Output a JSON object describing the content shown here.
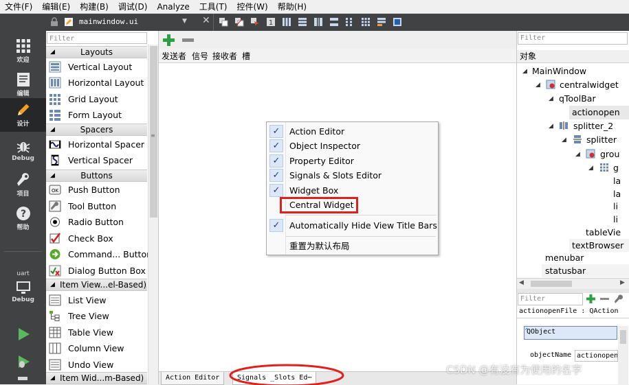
{
  "menubar": {
    "items": [
      "文件(F)",
      "编辑(E)",
      "构建(B)",
      "调试(D)",
      "Analyze",
      "工具(T)",
      "控件(W)",
      "帮助(H)"
    ]
  },
  "modes": [
    {
      "label": "欢迎",
      "icon": "grid-icon"
    },
    {
      "label": "编辑",
      "icon": "document-icon"
    },
    {
      "label": "设计",
      "icon": "pencil-icon",
      "active": true
    },
    {
      "label": "Debug",
      "icon": "bug-icon"
    },
    {
      "label": "项目",
      "icon": "wrench-icon"
    },
    {
      "label": "帮助",
      "icon": "help-icon"
    }
  ],
  "kit": {
    "name": "uart",
    "mode": "Debug"
  },
  "editor": {
    "file_name": "mainwindow.ui"
  },
  "widget_box": {
    "filter_placeholder": "Filter",
    "categories": {
      "layouts": "Layouts",
      "spacers": "Spacers",
      "buttons": "Buttons",
      "item_views": "Item View...el-Based)",
      "item_widgets": "Item Wid...m-Based)"
    },
    "items": {
      "vertical_layout": "Vertical Layout",
      "horizontal_layout": "Horizontal Layout",
      "grid_layout": "Grid Layout",
      "form_layout": "Form Layout",
      "horizontal_spacer": "Horizontal Spacer",
      "vertical_spacer": "Vertical Spacer",
      "push_button": "Push Button",
      "tool_button": "Tool Button",
      "radio_button": "Radio Button",
      "check_box": "Check Box",
      "command_button": "Command... Button",
      "dialog_button_box": "Dialog Button Box",
      "list_view": "List View",
      "tree_view": "Tree View",
      "table_view": "Table View",
      "column_view": "Column View",
      "undo_view": "Undo View"
    }
  },
  "signals_editor": {
    "columns": [
      "发送者",
      "信号",
      "接收者",
      "槽"
    ]
  },
  "bottom_tabs": [
    "Action Editor",
    "Signals _Slots Ed⋯"
  ],
  "context_menu": {
    "items": [
      {
        "label": "Action Editor",
        "checked": true
      },
      {
        "label": "Object Inspector",
        "checked": true
      },
      {
        "label": "Property Editor",
        "checked": true
      },
      {
        "label": "Signals & Slots Editor",
        "checked": true
      },
      {
        "label": "Widget Box",
        "checked": true
      },
      {
        "label": "Central Widget",
        "checked": false
      },
      {
        "label": "Automatically Hide View Title Bars",
        "checked": true
      },
      {
        "label": "重置为默认布局",
        "checked": false
      }
    ],
    "checkmark": "✓"
  },
  "object_inspector": {
    "filter_placeholder": "Filter",
    "header": "对象",
    "nodes": {
      "main_window": "MainWindow",
      "central_widget": "centralwidget",
      "tool_bar": "qToolBar",
      "action_open": "actionopen",
      "splitter_2": "splitter_2",
      "splitter": "splitter",
      "group": "grou",
      "g": "g",
      "leaf1": "la",
      "leaf2": "la",
      "leaf3": "li",
      "leaf4": "li",
      "table_view": "tableVie",
      "text_browser": "textBrowser",
      "menubar": "menubar",
      "statusbar": "statusbar"
    },
    "scroll_glyph": "▲ ▼"
  },
  "property_editor": {
    "filter_placeholder": "Filter",
    "object_label": "actionopenFile : QAction",
    "class_row": "QObject",
    "property_name": "objectName",
    "property_value": "actionopen"
  },
  "watermark": "CSDN @有没有为使用的名字",
  "colors": {
    "highlight_red": "#e0201c",
    "mode_bar": "#404244",
    "accent_green": "#2ea043"
  }
}
